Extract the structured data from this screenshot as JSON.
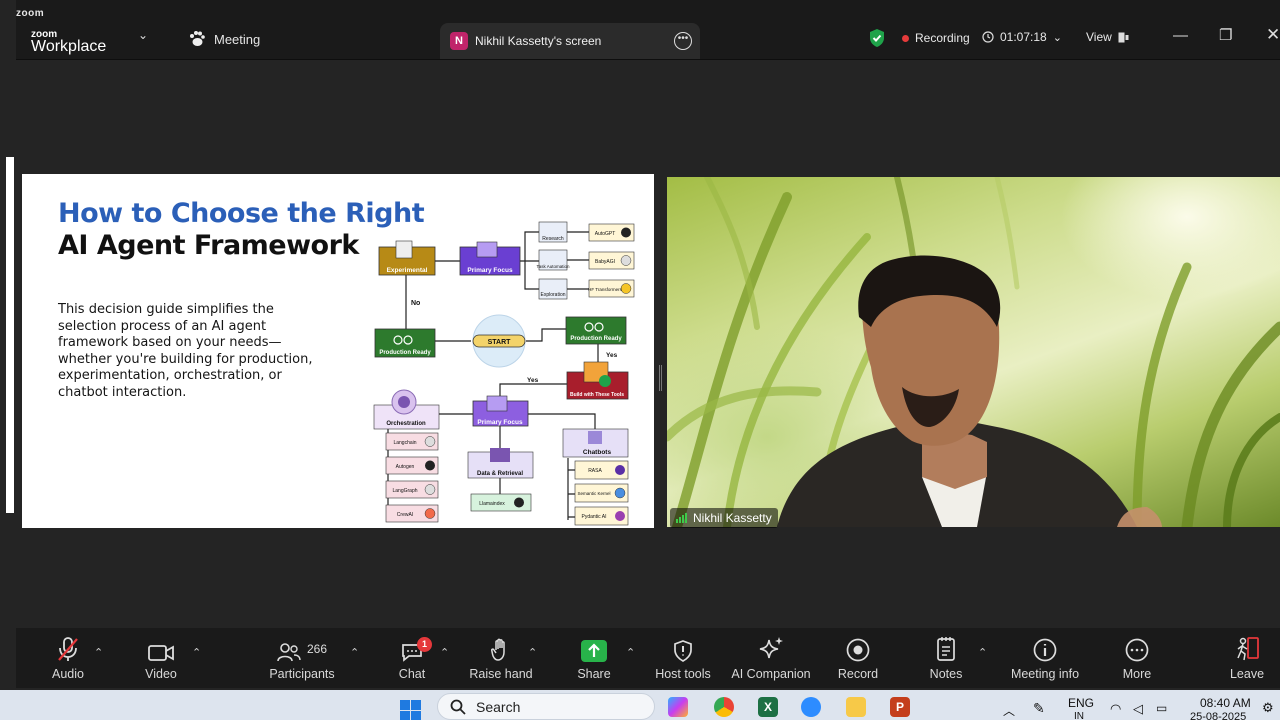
{
  "app": {
    "brand_small": "zoom",
    "brand_top": "zoom",
    "brand_name": "Workplace",
    "meeting_label": "Meeting"
  },
  "tab": {
    "avatar_letter": "N",
    "title": "Nikhil Kassetty's screen"
  },
  "status": {
    "recording_label": "Recording",
    "timer": "01:07:18",
    "view_label": "View"
  },
  "slide": {
    "title_line1": "How to Choose the Right",
    "title_line2": "AI Agent Framework",
    "description": "This decision guide simplifies the selection process of an AI agent framework based on your needs—whether you're building for production, experimentation, orchestration, or chatbot interaction.",
    "nodes": {
      "experimental": "Experimental",
      "primary_focus_top": "Primary Focus",
      "research": "Research",
      "task_automation": "Task Automation",
      "exploration": "Exploration",
      "autogpt": "AutoGPT",
      "babyagi": "BabyAGI",
      "hf_transformers": "HF Transformers",
      "no_label": "No",
      "production_ready_left": "Production Ready",
      "start": "START",
      "production_ready_right": "Production Ready",
      "yes_label_1": "Yes",
      "build_tools": "Build with These Tools",
      "yes_label_2": "Yes",
      "orchestration": "Orchestration",
      "primary_focus_mid": "Primary Focus",
      "chatbots": "Chatbots",
      "langchain": "Langchain",
      "autogen": "Autogen",
      "langgraph": "LangGraph",
      "crewai": "CrewAI",
      "data_retrieval": "Data & Retrieval",
      "llamaindex": "Llamaindex",
      "rasa": "RASA",
      "semantic_kernel": "Semantic Kernel",
      "pydantic_ai": "Pydantic AI"
    }
  },
  "video": {
    "participant_name": "Nikhil Kassetty"
  },
  "toolbar": {
    "audio": "Audio",
    "video": "Video",
    "participants": "Participants",
    "participants_count": "266",
    "chat": "Chat",
    "chat_badge": "1",
    "raise_hand": "Raise hand",
    "share": "Share",
    "host_tools": "Host tools",
    "ai_companion": "AI Companion",
    "record": "Record",
    "notes": "Notes",
    "meeting_info": "Meeting info",
    "more": "More",
    "leave": "Leave"
  },
  "taskbar": {
    "search_label": "Search",
    "language": "ENG",
    "language_sub": "IN",
    "time": "08:40 AM",
    "date": "25-08-2025"
  },
  "colors": {
    "accent_blue": "#2b5fb8",
    "share_green": "#28b34a",
    "recording_red": "#e53b3b",
    "shield_green": "#1fa34a"
  }
}
